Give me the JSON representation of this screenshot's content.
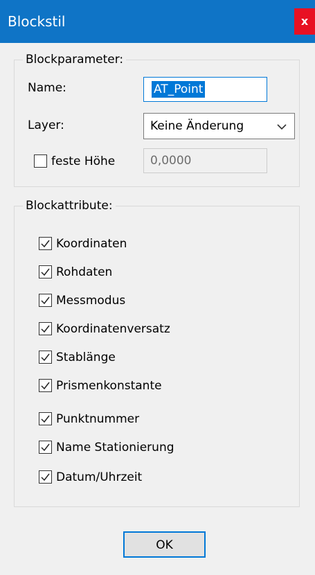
{
  "window": {
    "title": "Blockstil",
    "close_label": "x"
  },
  "block_parameters": {
    "legend": "Blockparameter:",
    "name_label": "Name:",
    "name_value": "AT_Point",
    "layer_label": "Layer:",
    "layer_value": "Keine Änderung",
    "fixed_height_label": "feste Höhe",
    "fixed_height_checked": false,
    "fixed_height_value": "0,0000"
  },
  "block_attributes": {
    "legend": "Blockattribute:",
    "items": [
      {
        "label": "Koordinaten",
        "checked": true
      },
      {
        "label": "Rohdaten",
        "checked": true
      },
      {
        "label": "Messmodus",
        "checked": true
      },
      {
        "label": "Koordinatenversatz",
        "checked": true
      },
      {
        "label": "Stablänge",
        "checked": true
      },
      {
        "label": "Prismenkonstante",
        "checked": true
      },
      {
        "label": "Punktnummer",
        "checked": true
      },
      {
        "label": "Name Stationierung",
        "checked": true
      },
      {
        "label": "Datum/Uhrzeit",
        "checked": true
      }
    ]
  },
  "footer": {
    "ok_label": "OK"
  },
  "colors": {
    "titlebar": "#0f74c6",
    "close": "#e81123",
    "accent": "#0078d7",
    "dialog_bg": "#f0f0f0"
  },
  "icons": {
    "close": "close-icon",
    "chevron": "chevron-down-icon",
    "check": "checkmark-icon"
  }
}
